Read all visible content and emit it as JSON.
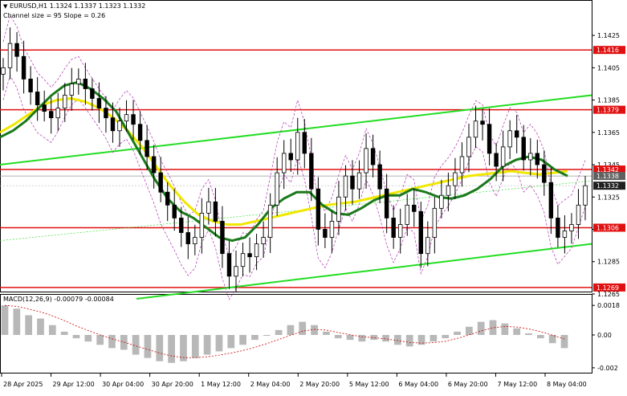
{
  "header": {
    "arrow": "▼",
    "symbol_line": "EURUSD,H1  1.1324 1.1337 1.1323 1.1332",
    "channel_line": "Channel size = 95 Slope = 0.26"
  },
  "price_axis": {
    "ticks": [
      "1.1425",
      "1.1405",
      "1.1385",
      "1.1365",
      "1.1345",
      "1.1325",
      "1.1305",
      "1.1285",
      "1.1265"
    ]
  },
  "price_labels": [
    {
      "value": "1.1416",
      "color": "#e01010"
    },
    {
      "value": "1.1379",
      "color": "#e01010"
    },
    {
      "value": "1.1342",
      "color": "#e01010"
    },
    {
      "value": "1.1338",
      "color": "#606060"
    },
    {
      "value": "1.1332",
      "color": "#202020"
    },
    {
      "value": "1.1306",
      "color": "#e01010"
    },
    {
      "value": "1.1269",
      "color": "#e01010"
    }
  ],
  "macd": {
    "label": "MACD(12,26,9) -0.00079 -0.00084",
    "ticks": [
      "0.0018",
      "0.00",
      "-0.002"
    ]
  },
  "time_axis": {
    "labels": [
      "28 Apr 2025",
      "29 Apr 12:00",
      "30 Apr 04:00",
      "30 Apr 20:00",
      "1 May 12:00",
      "2 May 04:00",
      "2 May 20:00",
      "5 May 12:00",
      "6 May 04:00",
      "6 May 20:00",
      "7 May 12:00",
      "8 May 04:00"
    ]
  },
  "colors": {
    "resistance": "#e01010",
    "channel": "#22dd22",
    "ma_fast": "#1a7a1a",
    "ma_slow": "#f0e800",
    "envelope": "#b030b0",
    "candle": "#000000",
    "macd_hist": "#b8b8b8",
    "macd_signal": "#cc0000"
  },
  "chart_data": {
    "type": "candlestick",
    "symbol": "EURUSD",
    "timeframe": "H1",
    "ohlc_last": {
      "open": 1.1324,
      "high": 1.1337,
      "low": 1.1323,
      "close": 1.1332
    },
    "horizontal_levels": [
      1.1416,
      1.1379,
      1.1342,
      1.1306,
      1.1269
    ],
    "current_price": 1.1332,
    "ylim": [
      1.1262,
      1.1432
    ],
    "close_path": [
      1.1405,
      1.142,
      1.1412,
      1.1398,
      1.139,
      1.1382,
      1.1378,
      1.1374,
      1.138,
      1.1388,
      1.1395,
      1.1398,
      1.1392,
      1.1386,
      1.138,
      1.1374,
      1.1366,
      1.1372,
      1.1376,
      1.137,
      1.136,
      1.135,
      1.134,
      1.1328,
      1.132,
      1.1312,
      1.1303,
      1.1296,
      1.13,
      1.1315,
      1.1322,
      1.131,
      1.129,
      1.1276,
      1.1282,
      1.129,
      1.1288,
      1.1296,
      1.13,
      1.132,
      1.134,
      1.1352,
      1.1348,
      1.1365,
      1.1352,
      1.133,
      1.1305,
      1.13,
      1.131,
      1.1325,
      1.1338,
      1.133,
      1.134,
      1.1355,
      1.1345,
      1.133,
      1.1312,
      1.13,
      1.1308,
      1.132,
      1.1316,
      1.129,
      1.13,
      1.1318,
      1.1326,
      1.1332,
      1.134,
      1.135,
      1.1362,
      1.1372,
      1.137,
      1.1352,
      1.1344,
      1.1356,
      1.1366,
      1.1362,
      1.1348,
      1.1352,
      1.1345,
      1.1334,
      1.1312,
      1.13,
      1.1304,
      1.1308,
      1.132,
      1.1332
    ],
    "ma_fast": [
      1.1362,
      1.1366,
      1.1372,
      1.138,
      1.1388,
      1.1394,
      1.1396,
      1.1392,
      1.1386,
      1.1378,
      1.1364,
      1.135,
      1.1336,
      1.1324,
      1.1316,
      1.1312,
      1.1306,
      1.13,
      1.1298,
      1.13,
      1.1308,
      1.1318,
      1.1324,
      1.1328,
      1.1328,
      1.132,
      1.1315,
      1.1314,
      1.1318,
      1.1323,
      1.1326,
      1.1326,
      1.133,
      1.1328,
      1.1325,
      1.1324,
      1.1326,
      1.133,
      1.1336,
      1.1344,
      1.1348,
      1.135,
      1.1348,
      1.1342,
      1.1338
    ],
    "ma_slow": [
      1.1365,
      1.137,
      1.1376,
      1.1382,
      1.1385,
      1.1386,
      1.1384,
      1.138,
      1.1374,
      1.1366,
      1.1356,
      1.1344,
      1.1332,
      1.1322,
      1.1314,
      1.131,
      1.1308,
      1.1308,
      1.131,
      1.1312,
      1.1314,
      1.1316,
      1.1318,
      1.132,
      1.1321,
      1.1322,
      1.1324,
      1.1326,
      1.1328,
      1.133,
      1.1332,
      1.1334,
      1.1336,
      1.1338,
      1.1339,
      1.134,
      1.1341,
      1.134,
      1.1339,
      1.134,
      1.1341
    ],
    "channel_upper": [
      1.1345,
      1.1388
    ],
    "channel_lower": [
      1.1262,
      1.1296
    ],
    "macd_ylim": [
      -0.0022,
      0.0022
    ],
    "macd_histogram": [
      0.0018,
      0.0016,
      0.0012,
      0.001,
      0.0006,
      0.0002,
      -0.0002,
      -0.0004,
      -0.0006,
      -0.0008,
      -0.0009,
      -0.0012,
      -0.0014,
      -0.0016,
      -0.0017,
      -0.0016,
      -0.0014,
      -0.0012,
      -0.001,
      -0.0008,
      -0.0006,
      -0.0003,
      0.0,
      0.0003,
      0.0006,
      0.0008,
      0.0006,
      0.0002,
      -0.0002,
      -0.0003,
      -0.0004,
      -0.0003,
      -0.0004,
      -0.0006,
      -0.0007,
      -0.0006,
      -0.0004,
      -0.0002,
      0.0002,
      0.0005,
      0.0008,
      0.0009,
      0.0007,
      0.0004,
      0.0001,
      -0.0002,
      -0.0005,
      -0.0008
    ],
    "macd_signal_value": -0.00084,
    "macd_value": -0.00079
  }
}
